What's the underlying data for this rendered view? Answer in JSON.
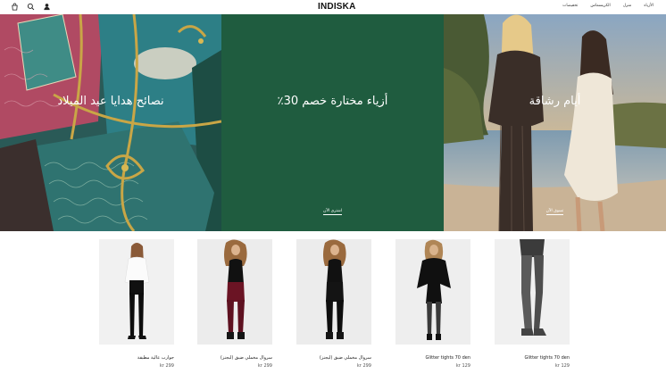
{
  "header": {
    "logo": "INDISKA",
    "nav": [
      "الأزياء",
      "منزل",
      "الكريسماس",
      "تخفيضات"
    ],
    "icons": [
      "bag-icon",
      "search-icon",
      "user-icon"
    ]
  },
  "hero": [
    {
      "title": "نصائح هدايا عيد الميلاد",
      "cta": ""
    },
    {
      "title": "أزياء مختارة خصم 30٪",
      "cta": "اشتري الآن"
    },
    {
      "title": "أيام رشاقة",
      "cta": "تسوق الآن"
    }
  ],
  "products": [
    {
      "name": "جوارب عالية مطبقة",
      "price": "kr 299"
    },
    {
      "name": "سروال مخملي ضيق (لبجنز)",
      "price": "kr 299"
    },
    {
      "name": "سروال مخملي ضيق (ليجنز)",
      "price": "kr 299"
    },
    {
      "name": "Glitter tights 70 den",
      "price": "kr 129"
    },
    {
      "name": "Glitter tights 70 den",
      "price": "kr 129"
    }
  ],
  "colors": {
    "sale_green": "#1f5c3f",
    "gift_teal": "#2f6f6a",
    "gift_red": "#a8404f",
    "burgundy": "#6b1424"
  }
}
